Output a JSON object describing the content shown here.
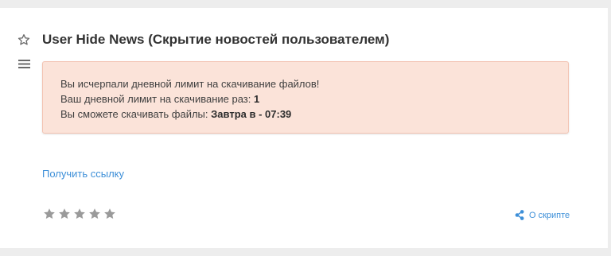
{
  "post": {
    "title": "User Hide News (Скрытие новостей пользователем)"
  },
  "alert": {
    "line1": "Вы исчерпали дневной лимит на скачивание файлов!",
    "line2_prefix": "Ваш дневной лимит на скачивание раз: ",
    "line2_value": "1",
    "line3_prefix": "Вы сможете скачивать файлы: ",
    "line3_value": "Завтра в - 07:39"
  },
  "actions": {
    "get_link_label": "Получить ссылку",
    "about_label": "О скрипте"
  },
  "rating": {
    "stars_total": 5,
    "stars_filled": 0
  },
  "icons": {
    "favorite": "star-outline-icon",
    "menu": "menu-icon",
    "rating": "star-icon",
    "share": "share-icon"
  },
  "colors": {
    "alert_bg": "#fbe3d9",
    "link": "#3d8fd8",
    "star": "#9a9a9a"
  }
}
